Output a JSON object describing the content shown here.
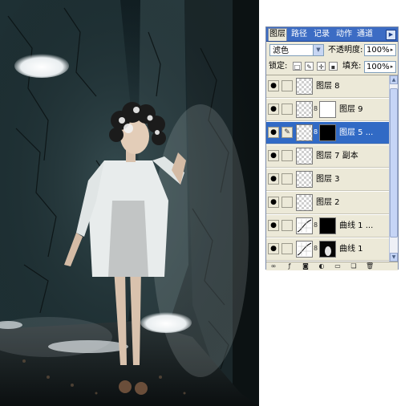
{
  "panel": {
    "tabs": [
      {
        "label": "图层"
      },
      {
        "label": "路径"
      },
      {
        "label": "记录"
      },
      {
        "label": "动作"
      },
      {
        "label": "通道"
      }
    ],
    "menu_icon": "triangle-right-icon",
    "blend_mode": "滤色",
    "opacity_label": "不透明度:",
    "opacity_value": "100%",
    "lock_label": "锁定:",
    "fill_label": "填充:",
    "fill_value": "100%",
    "layers": [
      {
        "name": "图层 8",
        "thumb": "transparent",
        "selected": false
      },
      {
        "name": "图层 9",
        "thumb": "transparent",
        "mask": "white",
        "selected": false
      },
      {
        "name": "图层 5 ...",
        "thumb": "transparent",
        "mask": "black",
        "selected": true
      },
      {
        "name": "图层 7 副本",
        "thumb": "transparent",
        "selected": false
      },
      {
        "name": "图层 3",
        "thumb": "transparent",
        "selected": false
      },
      {
        "name": "图层 2",
        "thumb": "transparent",
        "selected": false
      },
      {
        "name": "曲线 1 ...",
        "thumb": "curves",
        "mask": "black",
        "selected": false
      },
      {
        "name": "曲线 1",
        "thumb": "curves",
        "mask": "dark",
        "selected": false
      }
    ]
  },
  "colors": {
    "tab_bar": "#3c6cc4",
    "panel_bg": "#ece9d8",
    "selected_layer": "#316ac5"
  }
}
